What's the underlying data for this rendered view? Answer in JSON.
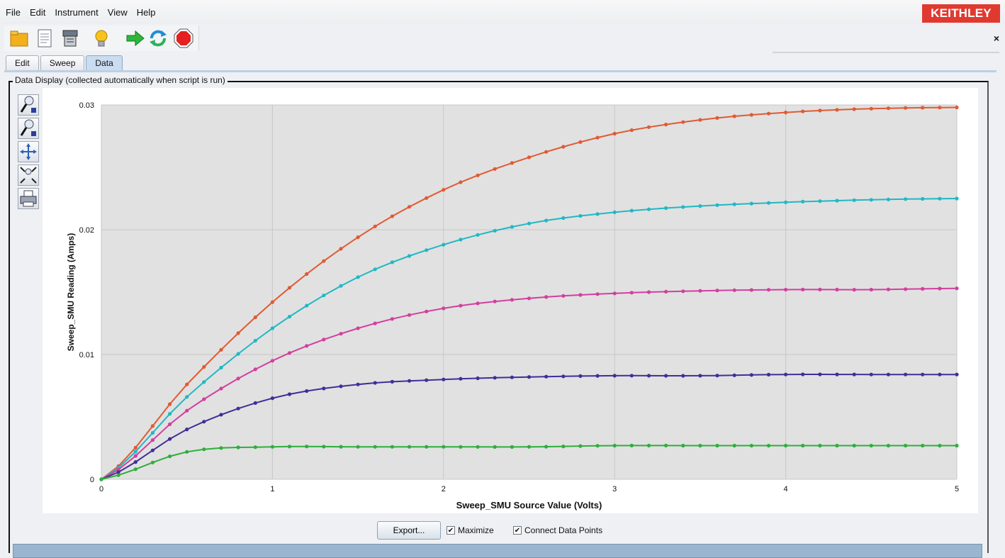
{
  "menubar": {
    "items": [
      "File",
      "Edit",
      "Instrument",
      "View",
      "Help"
    ],
    "brand": "KEITHLEY"
  },
  "toolbar": {
    "icons": [
      "open-folder-icon",
      "script-icon",
      "instrument-icon",
      "lightbulb-icon",
      "run-icon",
      "refresh-icon",
      "stop-icon"
    ]
  },
  "close_label": "×",
  "tabs": [
    {
      "label": "Edit"
    },
    {
      "label": "Sweep"
    },
    {
      "label": "Data",
      "active": true
    }
  ],
  "panel": {
    "title": "Data Display (collected automatically when script is run)"
  },
  "colors": {
    "series": [
      "#e05a33",
      "#20b8c4",
      "#d23f9e",
      "#3f2f99",
      "#2fae3c"
    ],
    "plot_bg": "#e1e1e1",
    "brand": "#e03a30"
  },
  "chart_data": {
    "type": "line",
    "xlabel": "Sweep_SMU Source Value (Volts)",
    "ylabel": "Sweep_SMU Reading (Amps)",
    "xlim": [
      0,
      5
    ],
    "ylim": [
      0,
      0.03
    ],
    "xticks": [
      "0",
      "1",
      "2",
      "3",
      "4",
      "5"
    ],
    "yticks": [
      "0",
      "0.01",
      "0.02",
      "0.03"
    ],
    "grid": true,
    "x": [
      0,
      0.5,
      1.0,
      1.5,
      2.0,
      2.5,
      3.0,
      3.5,
      4.0,
      4.5,
      5.0
    ],
    "series": [
      {
        "values": [
          0,
          0.0076,
          0.0142,
          0.0194,
          0.0232,
          0.0258,
          0.0277,
          0.0288,
          0.0294,
          0.0297,
          0.0298
        ]
      },
      {
        "values": [
          0,
          0.0066,
          0.0121,
          0.0162,
          0.0188,
          0.0205,
          0.0214,
          0.0219,
          0.0222,
          0.0224,
          0.0225
        ]
      },
      {
        "values": [
          0,
          0.0055,
          0.0095,
          0.0121,
          0.0137,
          0.0145,
          0.0149,
          0.0151,
          0.0152,
          0.0152,
          0.0153
        ]
      },
      {
        "values": [
          0,
          0.004,
          0.0065,
          0.0076,
          0.008,
          0.0082,
          0.0083,
          0.0083,
          0.0084,
          0.0084,
          0.0084
        ]
      },
      {
        "values": [
          0,
          0.0022,
          0.0026,
          0.0026,
          0.0026,
          0.0026,
          0.0027,
          0.0027,
          0.0027,
          0.0027,
          0.0027
        ]
      }
    ]
  },
  "controls": {
    "export_label": "Export...",
    "maximize_label": "Maximize",
    "maximize_checked": true,
    "connect_label": "Connect Data Points",
    "connect_checked": true
  }
}
